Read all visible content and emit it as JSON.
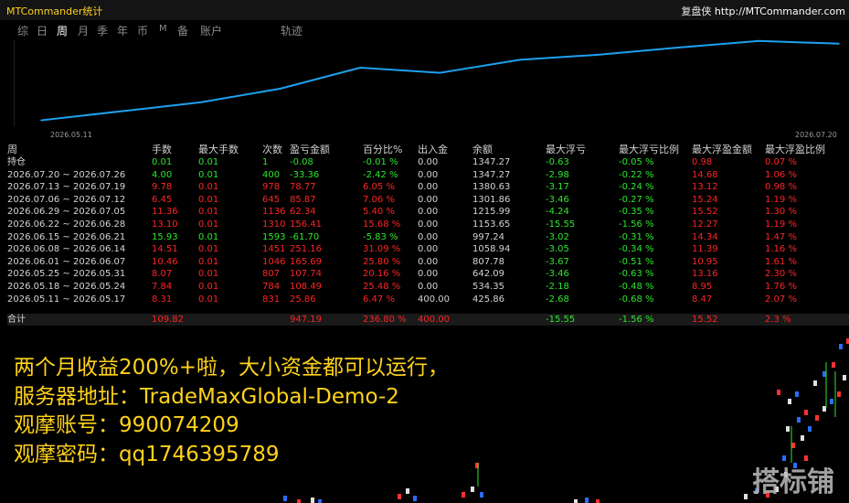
{
  "window": {
    "title": "MTCommander统计",
    "brand_name": "复盘侠",
    "brand_url": "http://MTCommander.com"
  },
  "tabs": [
    {
      "label": "综"
    },
    {
      "label": "日"
    },
    {
      "label": "周",
      "active": true
    },
    {
      "label": "月"
    },
    {
      "label": "季"
    },
    {
      "label": "年"
    },
    {
      "label": "币"
    },
    {
      "label": "M"
    },
    {
      "label": "备"
    },
    {
      "label": "账户"
    },
    {
      "label": "轨迹"
    }
  ],
  "chart_data": {
    "type": "line",
    "x": [
      "2026.05.11",
      "2026.05.18",
      "2026.05.25",
      "2026.06.01",
      "2026.06.08",
      "2026.06.15",
      "2026.06.22",
      "2026.06.29",
      "2026.07.06",
      "2026.07.13",
      "2026.07.20"
    ],
    "series": [
      {
        "values": [
          425.86,
          534.35,
          642.09,
          807.78,
          1058.94,
          997.24,
          1153.65,
          1215.99,
          1301.86,
          1380.63,
          1347.27
        ]
      }
    ],
    "x_start_label": "2026.05.11",
    "x_end_label": "2026.07.20",
    "color": "#1ea0f0",
    "grid": false
  },
  "table": {
    "headers": [
      "周",
      "手数",
      "最大手数",
      "次数",
      "盈亏金额",
      "百分比%",
      "出入金",
      "余额",
      "最大浮亏",
      "最大浮亏比例",
      "最大浮盈金额",
      "最大浮盈比例"
    ],
    "rows": [
      [
        "持仓",
        "0.01",
        "0.01",
        "1",
        "-0.08",
        "-0.01 %",
        "0.00",
        "1347.27",
        "-0.63",
        "-0.05 %",
        "0.98",
        "0.07 %"
      ],
      [
        "2026.07.20 ~ 2026.07.26",
        "4.00",
        "0.01",
        "400",
        "-33.36",
        "-2.42 %",
        "0.00",
        "1347.27",
        "-2.98",
        "-0.22 %",
        "14.68",
        "1.06 %"
      ],
      [
        "2026.07.13 ~ 2026.07.19",
        "9.78",
        "0.01",
        "978",
        "78.77",
        "6.05 %",
        "0.00",
        "1380.63",
        "-3.17",
        "-0.24 %",
        "13.12",
        "0.98 %"
      ],
      [
        "2026.07.06 ~ 2026.07.12",
        "6.45",
        "0.01",
        "645",
        "85.87",
        "7.06 %",
        "0.00",
        "1301.86",
        "-3.46",
        "-0.27 %",
        "15.24",
        "1.19 %"
      ],
      [
        "2026.06.29 ~ 2026.07.05",
        "11.36",
        "0.01",
        "1136",
        "62.34",
        "5.40 %",
        "0.00",
        "1215.99",
        "-4.24",
        "-0.35 %",
        "15.52",
        "1.30 %"
      ],
      [
        "2026.06.22 ~ 2026.06.28",
        "13.10",
        "0.01",
        "1310",
        "156.41",
        "15.68 %",
        "0.00",
        "1153.65",
        "-15.55",
        "-1.56 %",
        "12.27",
        "1.19 %"
      ],
      [
        "2026.06.15 ~ 2026.06.21",
        "15.93",
        "0.01",
        "1593",
        "-61.70",
        "-5.83 %",
        "0.00",
        "997.24",
        "-3.02",
        "-0.31 %",
        "14.34",
        "1.47 %"
      ],
      [
        "2026.06.08 ~ 2026.06.14",
        "14.51",
        "0.01",
        "1451",
        "251.16",
        "31.09 %",
        "0.00",
        "1058.94",
        "-3.05",
        "-0.34 %",
        "11.39",
        "1.16 %"
      ],
      [
        "2026.06.01 ~ 2026.06.07",
        "10.46",
        "0.01",
        "1046",
        "165.69",
        "25.80 %",
        "0.00",
        "807.78",
        "-3.67",
        "-0.51 %",
        "10.95",
        "1.61 %"
      ],
      [
        "2026.05.25 ~ 2026.05.31",
        "8.07",
        "0.01",
        "807",
        "107.74",
        "20.16 %",
        "0.00",
        "642.09",
        "-3.46",
        "-0.63 %",
        "13.16",
        "2.30 %"
      ],
      [
        "2026.05.18 ~ 2026.05.24",
        "7.84",
        "0.01",
        "784",
        "108.49",
        "25.48 %",
        "0.00",
        "534.35",
        "-2.18",
        "-0.48 %",
        "8.95",
        "1.76 %"
      ],
      [
        "2026.05.11 ~ 2026.05.17",
        "8.31",
        "0.01",
        "831",
        "25.86",
        "6.47 %",
        "400.00",
        "425.86",
        "-2.68",
        "-0.68 %",
        "8.47",
        "2.07 %"
      ]
    ],
    "total": [
      "合计",
      "109.82",
      "",
      "",
      "947.19",
      "236.80 %",
      "400.00",
      "",
      "-15.55",
      "-1.56 %",
      "15.52",
      "2.3 %"
    ]
  },
  "promo": {
    "line1": "两个月收益200%+啦，大小资金都可以运行，",
    "line2": "服务器地址：TradeMaxGlobal-Demo-2",
    "line3": "观摩账号：990074209",
    "line4": "观摩密码：qq1746395789"
  },
  "watermark": "搭标铺",
  "colors": {
    "title_yellow": "#ffd21a",
    "green": "#2ee62e",
    "red": "#ff2424",
    "line_blue": "#1ea0f0"
  }
}
